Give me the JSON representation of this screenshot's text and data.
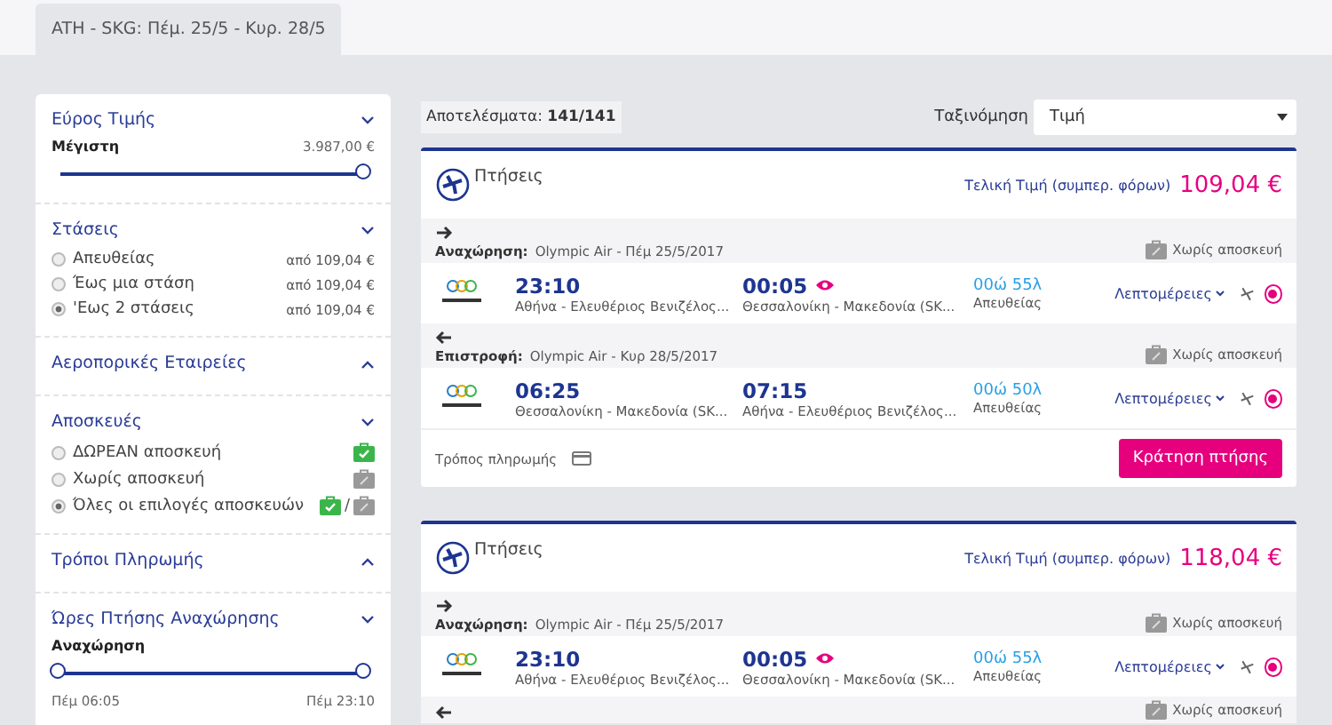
{
  "tabs": [
    {
      "label": "ATH - SKG: Πέμ. 25/5 - Κυρ. 28/5",
      "selected": true
    }
  ],
  "filters": [
    {
      "kind": "slider",
      "title": "Εύρος Τιμής",
      "expanded": true,
      "label": "Μέγιστη",
      "value": "3.987,00 €",
      "level": 1
    },
    {
      "kind": "radios",
      "title": "Στάσεις",
      "expanded": true,
      "options": [
        {
          "label": "Απευθείας",
          "price": "από 109,04 €",
          "selected": false
        },
        {
          "label": "Έως μια στάση",
          "price": "από 109,04 €",
          "selected": false
        },
        {
          "label": "'Εως 2 στάσεις",
          "price": "από 109,04 €",
          "selected": true
        }
      ]
    },
    {
      "kind": "header",
      "title": "Αεροπορικές Εταιρείες",
      "expanded": false
    },
    {
      "kind": "radios",
      "title": "Αποσκευές",
      "expanded": true,
      "options": [
        {
          "label": "ΔΩΡΕΑΝ αποσκευή",
          "kind": "free",
          "selected": false
        },
        {
          "label": "Χωρίς αποσκευή",
          "kind": "none",
          "selected": false
        },
        {
          "label": "Όλες οι επιλογές αποσκευών",
          "kind": "both",
          "separator": "/",
          "selected": true
        }
      ]
    },
    {
      "kind": "header",
      "title": "Τρόποι Πληρωμής",
      "expanded": false
    },
    {
      "kind": "range",
      "title": "Ώρες Πτήσης Αναχώρησης",
      "expanded": true,
      "label": "Αναχώρηση",
      "thumbs": [
        {
          "level": 0
        },
        {
          "level": 1
        }
      ],
      "min_label": "Πέμ 06:05",
      "max_label": "Πέμ 23:10"
    }
  ],
  "results": {
    "label": "Αποτελέσματα:",
    "count": "141/141"
  },
  "sort": {
    "label": "Ταξινόμηση",
    "value": "Τιμή"
  },
  "cards": [
    {
      "title": "Πτήσεις",
      "price_label": "Τελική Τιμή (συμπερ. φόρων)",
      "price": "109,04 €",
      "legs": [
        {
          "kind": "outbound",
          "label": "Αναχώρηση:",
          "info": "Olympic Air - Πέμ 25/5/2017",
          "baggage": "Χωρίς αποσκευή",
          "flight": {
            "dep_time": "23:10",
            "dep_airport": "Αθήνα - Ελευθέριος Βενιζέλος...",
            "arr_time": "00:05",
            "next_day": true,
            "arr_airport": "Θεσσαλονίκη - Μακεδονία (SK...",
            "duration": "00ώ 55λ",
            "stops": "Απευθείας",
            "details": "Λεπτομέρειες",
            "selected": true
          }
        },
        {
          "kind": "return",
          "label": "Επιστροφή:",
          "info": "Olympic Air - Κυρ 28/5/2017",
          "baggage": "Χωρίς αποσκευή",
          "flight": {
            "dep_time": "06:25",
            "dep_airport": "Θεσσαλονίκη - Μακεδονία (SK...",
            "arr_time": "07:15",
            "next_day": false,
            "arr_airport": "Αθήνα - Ελευθέριος Βενιζέλος...",
            "duration": "00ώ 50λ",
            "stops": "Απευθείας",
            "details": "Λεπτομέρειες",
            "selected": true
          }
        }
      ],
      "payment_label": "Τρόπος πληρωμής",
      "book_button": "Κράτηση πτήσης"
    },
    {
      "title": "Πτήσεις",
      "price_label": "Τελική Τιμή (συμπερ. φόρων)",
      "price": "118,04 €",
      "legs": [
        {
          "kind": "outbound",
          "label": "Αναχώρηση:",
          "info": "Olympic Air - Πέμ 25/5/2017",
          "baggage": "Χωρίς αποσκευή",
          "flight": {
            "dep_time": "23:10",
            "dep_airport": "Αθήνα - Ελευθέριος Βενιζέλος...",
            "arr_time": "00:05",
            "next_day": true,
            "arr_airport": "Θεσσαλονίκη - Μακεδονία (SK...",
            "duration": "00ώ 55λ",
            "stops": "Απευθείας",
            "details": "Λεπτομέρειες",
            "selected": true
          }
        },
        {
          "kind": "return",
          "baggage": "Χωρίς αποσκευή"
        }
      ]
    }
  ]
}
